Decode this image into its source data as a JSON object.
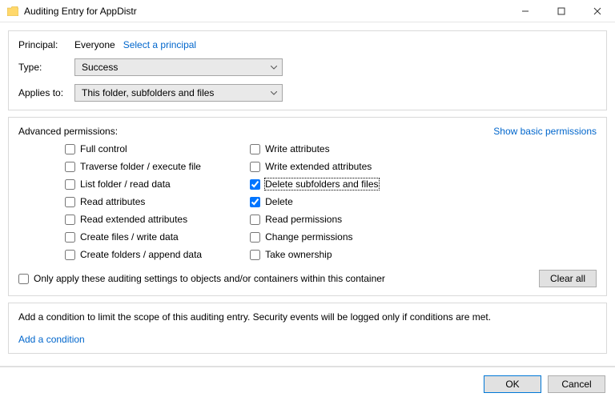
{
  "window": {
    "title": "Auditing Entry for AppDistr"
  },
  "topPanel": {
    "principal_label": "Principal:",
    "principal_value": "Everyone",
    "select_principal_link": "Select a principal",
    "type_label": "Type:",
    "type_value": "Success",
    "applies_label": "Applies to:",
    "applies_value": "This folder, subfolders and files"
  },
  "permPanel": {
    "heading": "Advanced permissions:",
    "show_basic_link": "Show basic permissions",
    "col1": [
      {
        "label": "Full control",
        "checked": false
      },
      {
        "label": "Traverse folder / execute file",
        "checked": false
      },
      {
        "label": "List folder / read data",
        "checked": false
      },
      {
        "label": "Read attributes",
        "checked": false
      },
      {
        "label": "Read extended attributes",
        "checked": false
      },
      {
        "label": "Create files / write data",
        "checked": false
      },
      {
        "label": "Create folders / append data",
        "checked": false
      }
    ],
    "col2": [
      {
        "label": "Write attributes",
        "checked": false
      },
      {
        "label": "Write extended attributes",
        "checked": false
      },
      {
        "label": "Delete subfolders and files",
        "checked": true,
        "focused": true
      },
      {
        "label": "Delete",
        "checked": true
      },
      {
        "label": "Read permissions",
        "checked": false
      },
      {
        "label": "Change permissions",
        "checked": false
      },
      {
        "label": "Take ownership",
        "checked": false
      }
    ],
    "only_apply_label": "Only apply these auditing settings to objects and/or containers within this container",
    "only_apply_checked": false,
    "clear_all_label": "Clear all"
  },
  "condPanel": {
    "desc": "Add a condition to limit the scope of this auditing entry. Security events will be logged only if conditions are met.",
    "add_link": "Add a condition"
  },
  "footer": {
    "ok": "OK",
    "cancel": "Cancel"
  }
}
